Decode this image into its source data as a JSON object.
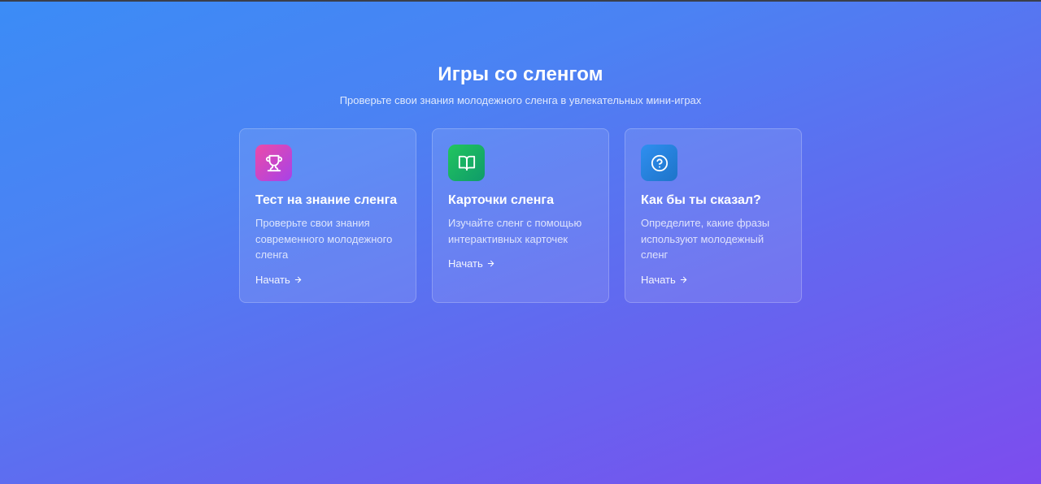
{
  "header": {
    "title": "Игры со сленгом",
    "subtitle": "Проверьте свои знания молодежного сленга в увлекательных мини-играх"
  },
  "cards": [
    {
      "icon": "trophy-icon",
      "title": "Тест на знание сленга",
      "description": "Проверьте свои знания современного молодежного сленга",
      "action": "Начать"
    },
    {
      "icon": "book-open-icon",
      "title": "Карточки сленга",
      "description": "Изучайте сленг с помощью интерактивных карточек",
      "action": "Начать"
    },
    {
      "icon": "question-circle-icon",
      "title": "Как бы ты сказал?",
      "description": "Определите, какие фразы используют молодежный сленг",
      "action": "Начать"
    }
  ],
  "colors": {
    "background_start": "#3b8cf6",
    "background_end": "#7d4cee",
    "icon_pink": "#ec4aa8",
    "icon_green": "#22c55e",
    "icon_blue": "#2f8ff0"
  }
}
